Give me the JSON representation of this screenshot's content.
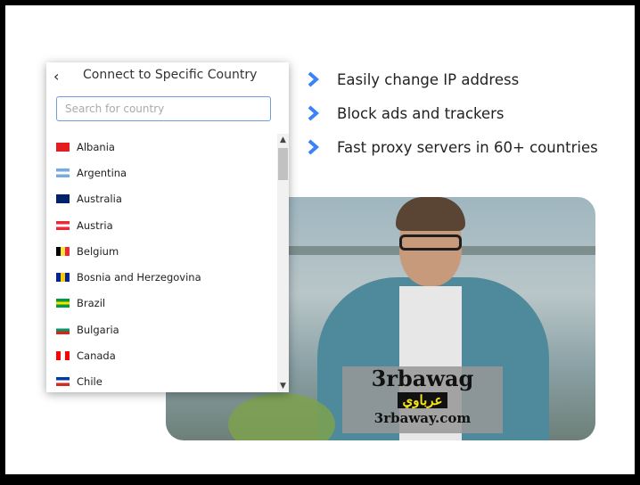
{
  "features": [
    {
      "text": "Easily change IP address",
      "icon": "chevron-right-icon"
    },
    {
      "text": "Block ads and trackers",
      "icon": "chevron-right-icon"
    },
    {
      "text": "Fast proxy servers in 60+ countries",
      "icon": "chevron-right-icon"
    }
  ],
  "accent": "#3b82f6",
  "panel": {
    "back_icon": "‹",
    "title": "Connect to Specific Country",
    "search_placeholder": "Search for country",
    "countries": [
      {
        "name": "Albania",
        "colors": [
          "#e41e20",
          "#e41e20"
        ]
      },
      {
        "name": "Argentina",
        "colors": [
          "#74acdf",
          "#ffffff",
          "#74acdf"
        ]
      },
      {
        "name": "Australia",
        "colors": [
          "#012169",
          "#012169"
        ]
      },
      {
        "name": "Austria",
        "colors": [
          "#ed2939",
          "#ffffff",
          "#ed2939"
        ]
      },
      {
        "name": "Belgium",
        "colors": [
          "#000000",
          "#fae042",
          "#ed2939"
        ],
        "vertical": true
      },
      {
        "name": "Bosnia and Herzegovina",
        "colors": [
          "#002395",
          "#fecb00",
          "#002395"
        ],
        "vertical": true
      },
      {
        "name": "Brazil",
        "colors": [
          "#009c3b",
          "#ffdf00",
          "#009c3b"
        ]
      },
      {
        "name": "Bulgaria",
        "colors": [
          "#ffffff",
          "#00966e",
          "#d62612"
        ]
      },
      {
        "name": "Canada",
        "colors": [
          "#ff0000",
          "#ffffff",
          "#ff0000"
        ],
        "vertical": true
      },
      {
        "name": "Chile",
        "colors": [
          "#0039a6",
          "#ffffff",
          "#d52b1e"
        ]
      }
    ]
  },
  "watermark": {
    "line1": "3rbawag",
    "line2": "عرباوي",
    "line3": "3rbaway.com"
  }
}
